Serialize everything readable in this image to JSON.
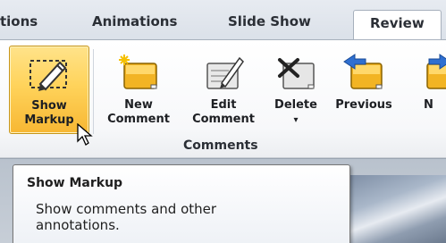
{
  "tabs": {
    "items": [
      {
        "label": "tions"
      },
      {
        "label": "Animations"
      },
      {
        "label": "Slide Show"
      },
      {
        "label": "Review"
      }
    ]
  },
  "ribbon": {
    "buttons": [
      {
        "line1": "Show",
        "line2": "Markup",
        "icon": "show-markup-icon"
      },
      {
        "line1": "New",
        "line2": "Comment",
        "icon": "new-comment-icon"
      },
      {
        "line1": "Edit",
        "line2": "Comment",
        "icon": "edit-comment-icon"
      },
      {
        "line1": "Delete",
        "line2": "▾",
        "icon": "delete-comment-icon"
      },
      {
        "line1": "Previous",
        "line2": "",
        "icon": "previous-comment-icon"
      },
      {
        "line1": "N",
        "line2": "",
        "icon": "next-comment-icon"
      }
    ],
    "group_label": "Comments"
  },
  "tooltip": {
    "title": "Show Markup",
    "body": "Show comments and other annotations."
  },
  "colors": {
    "accent": "#f2b424",
    "pressed": "#ffd35b",
    "tab_active": "#ffffff"
  }
}
